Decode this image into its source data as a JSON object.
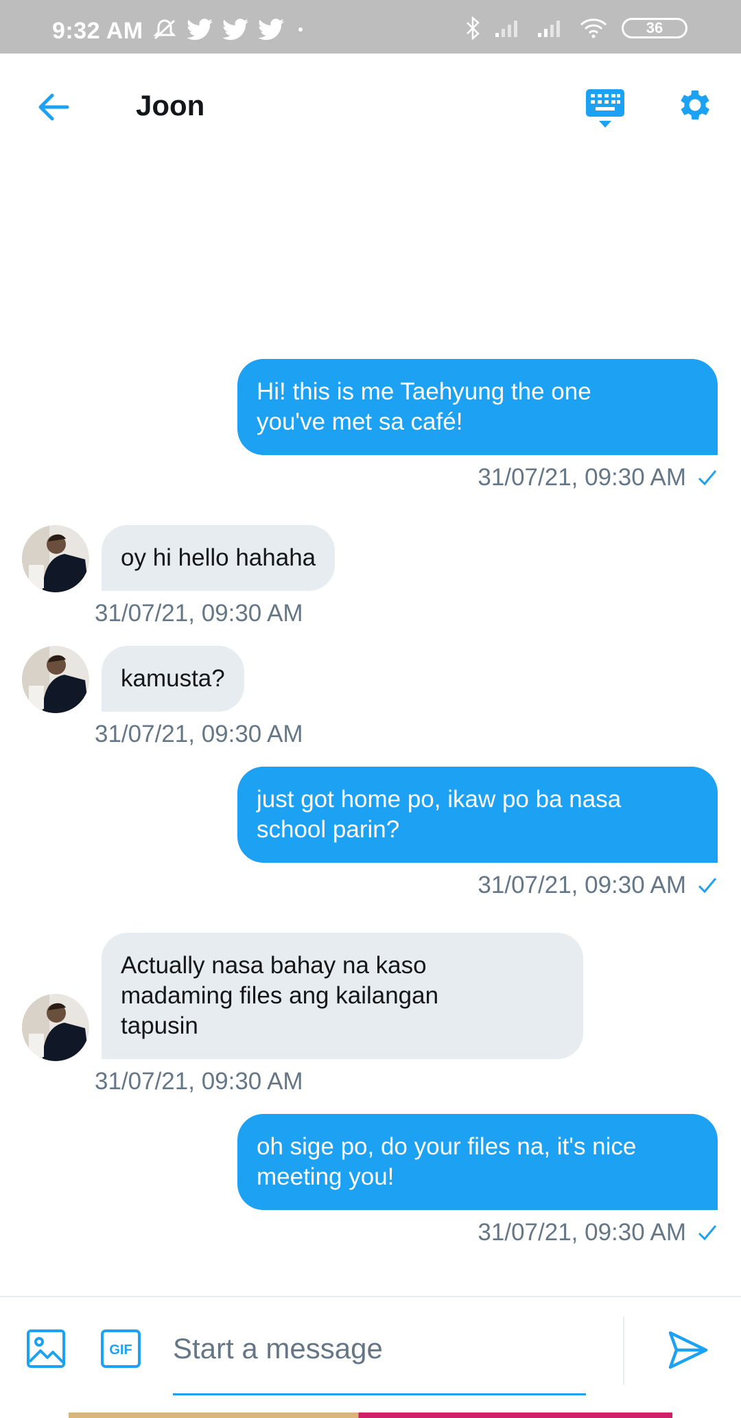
{
  "status_bar": {
    "time": "9:32 AM",
    "battery": "36",
    "left_icons": [
      "mute-bell-icon",
      "twitter-icon",
      "twitter-icon",
      "twitter-icon",
      "dot-icon"
    ],
    "right_icons": [
      "bluetooth-icon",
      "signal-icon",
      "signal-icon",
      "wifi-icon",
      "battery-icon"
    ]
  },
  "header": {
    "title": "Joon",
    "back_icon": "arrow-left-icon",
    "keyboard_icon": "keyboard-icon",
    "settings_icon": "gear-icon"
  },
  "colors": {
    "accent": "#1da1f2",
    "incoming_bubble": "#e6ecf0",
    "muted_text": "#657786"
  },
  "messages": [
    {
      "direction": "outgoing",
      "lines": [
        "Hi! this is me Taehyung the one",
        "you've met sa café!"
      ],
      "timestamp": "31/07/21, 09:30 AM"
    },
    {
      "direction": "incoming",
      "lines": [
        "oy hi hello hahaha"
      ],
      "timestamp": "31/07/21, 09:30 AM"
    },
    {
      "direction": "incoming",
      "lines": [
        "kamusta?"
      ],
      "timestamp": "31/07/21, 09:30 AM"
    },
    {
      "direction": "outgoing",
      "lines": [
        "just got home po, ikaw po ba nasa",
        "school parin?"
      ],
      "timestamp": "31/07/21, 09:30 AM"
    },
    {
      "direction": "incoming",
      "lines": [
        "Actually nasa bahay na kaso",
        "madaming files ang kailangan",
        "tapusin"
      ],
      "timestamp": "31/07/21, 09:30 AM"
    },
    {
      "direction": "outgoing",
      "lines": [
        "oh sige po, do your files na, it's nice",
        "meeting you!"
      ],
      "timestamp": "31/07/21, 09:30 AM"
    }
  ],
  "composer": {
    "placeholder": "Start a message",
    "gif_label": "GIF",
    "media_icon": "image-icon",
    "send_icon": "send-icon"
  }
}
